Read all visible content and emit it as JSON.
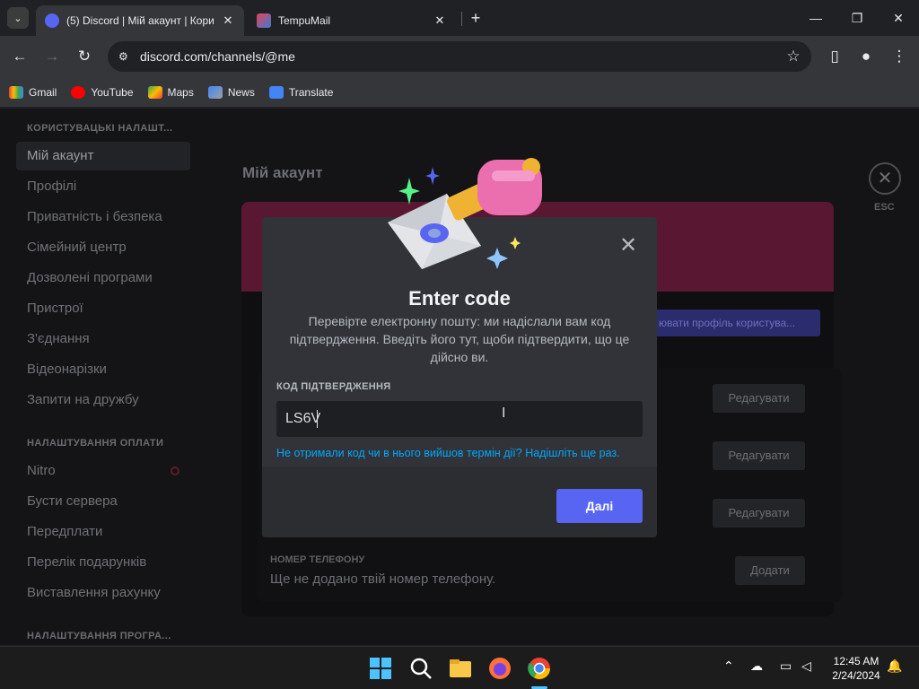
{
  "browser": {
    "tabs": [
      {
        "title": "(5) Discord | Мій акаунт | Кори",
        "active": true
      },
      {
        "title": "TempuMail",
        "active": false
      }
    ],
    "url": "discord.com/channels/@me",
    "bookmarks": [
      "Gmail",
      "YouTube",
      "Maps",
      "News",
      "Translate"
    ]
  },
  "sidebar": {
    "section1": "КОРИСТУВАЦЬКІ НАЛАШТ...",
    "items1": [
      "Мій акаунт",
      "Профілі",
      "Приватність і безпека",
      "Сімейний центр",
      "Дозволені програми",
      "Пристрої",
      "З'єднання",
      "Відеонарізки",
      "Запити на дружбу"
    ],
    "section2": "НАЛАШТУВАННЯ ОПЛАТИ",
    "items2": [
      "Nitro",
      "Бусти сервера",
      "Передплати",
      "Перелік подарунків",
      "Виставлення рахунку"
    ],
    "section3": "НАЛАШТУВАННЯ ПРОГРА..."
  },
  "content": {
    "title": "Мій акаунт",
    "profile_button": "ювати профіль користува...",
    "edit_label": "Редагувати",
    "add_label": "Додати",
    "phone_label": "НОМЕР ТЕЛЕФОНУ",
    "phone_value": "Ще не додано твій номер телефону.",
    "esc_label": "ESC"
  },
  "modal": {
    "title": "Enter code",
    "description": "Перевірте електронну пошту: ми надіслали вам код підтвердження. Введіть його тут, щоби підтвердити, що це дійсно ви.",
    "code_label": "КОД ПІДТВЕРДЖЕННЯ",
    "code_value": "LS6V",
    "resend_text": "Не отримали код чи в нього вийшов термін дії? Надішліть ще раз.",
    "next_label": "Далі"
  },
  "taskbar": {
    "time": "12:45 AM",
    "date": "2/24/2024"
  },
  "colors": {
    "accent": "#5865f2",
    "link": "#00a8fc"
  }
}
